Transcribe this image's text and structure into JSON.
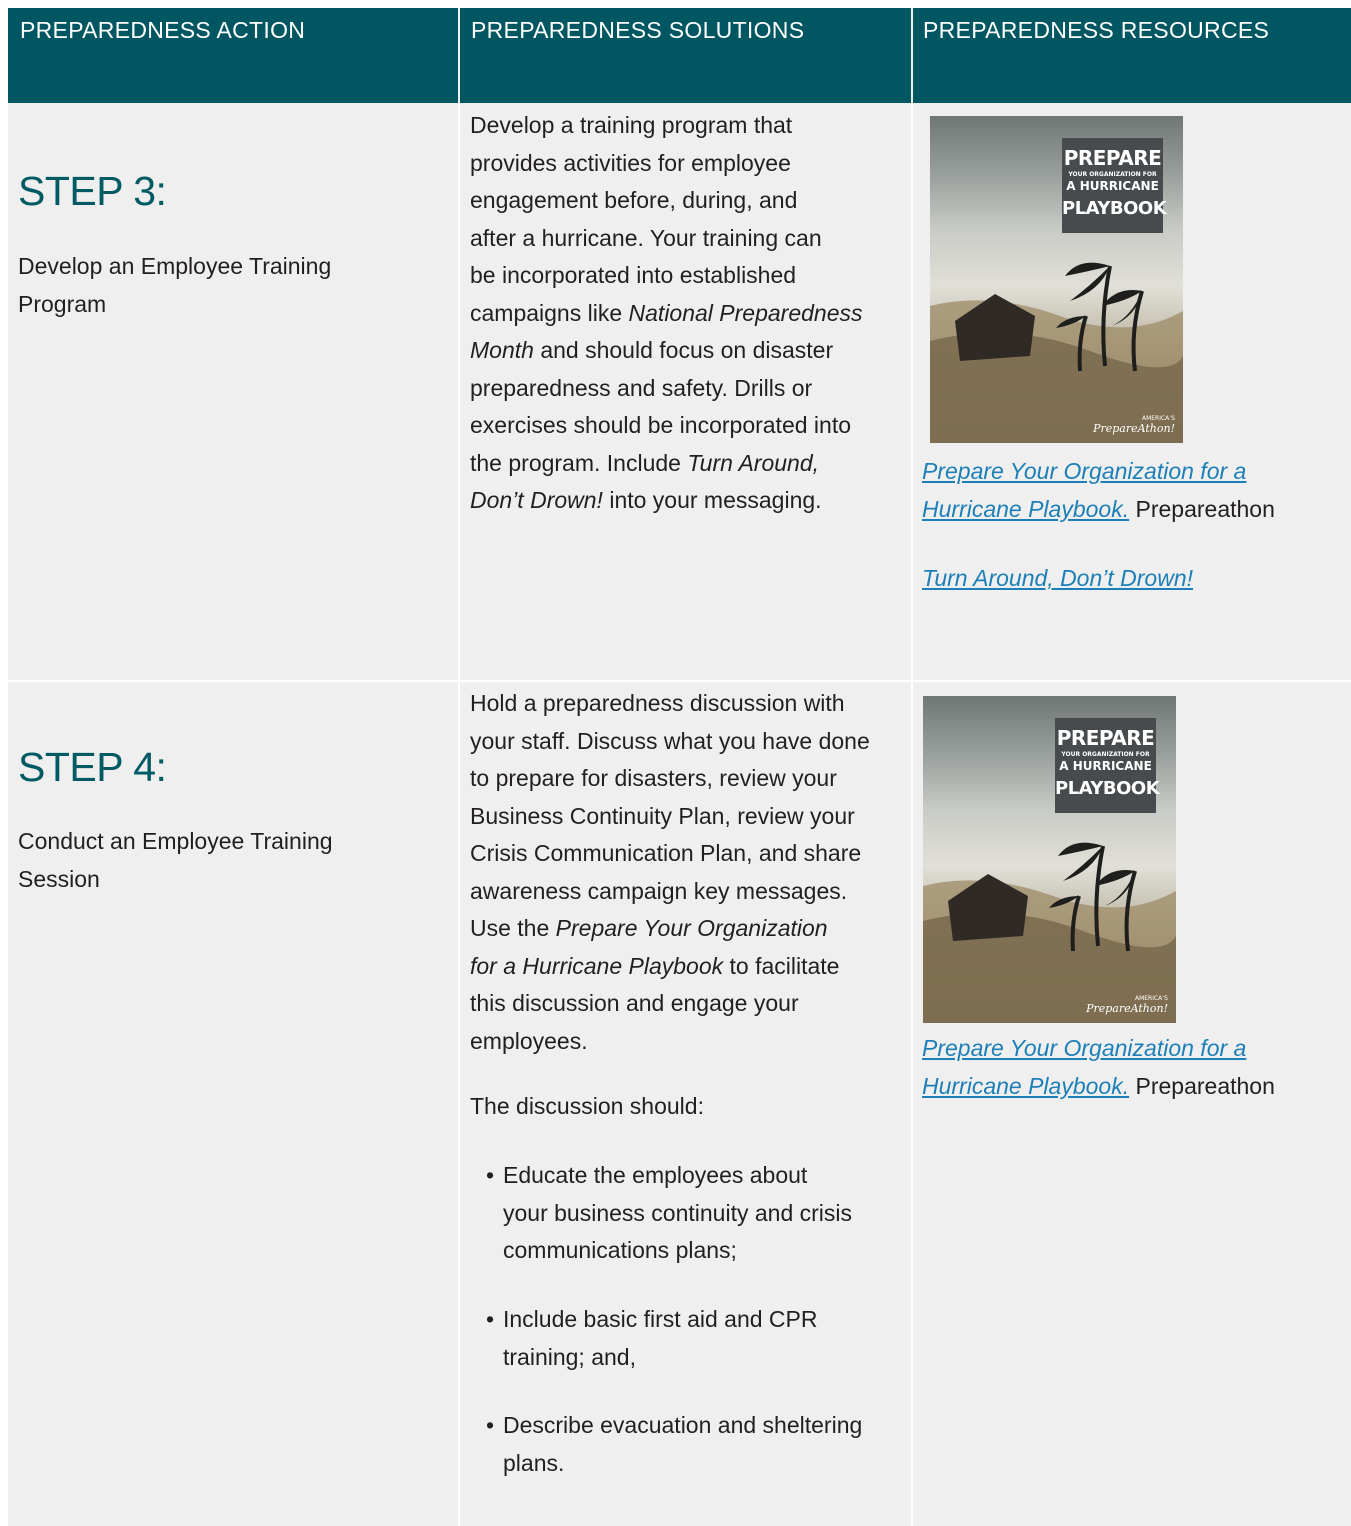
{
  "headers": {
    "action": "PREPAREDNESS ACTION",
    "solutions": "PREPAREDNESS SOLUTIONS",
    "resources": "PREPAREDNESS RESOURCES"
  },
  "rows": [
    {
      "step": "STEP 3:",
      "action": "Develop an Employee Training Program",
      "solution": {
        "lines": [
          "Develop a training program that",
          "provides activities for employee",
          "engagement before, during, and",
          "after a hurricane. Your training can",
          "be incorporated into established",
          "campaigns like "
        ],
        "l6_italic": "National Preparedness",
        "l7_italic": "Month",
        "l7_rest": " and should focus on disaster",
        "l8": "preparedness and safety. Drills or",
        "l9": "exercises should be incorporated into",
        "l10_pre": "the program. Include ",
        "l10_italic": "Turn Around,",
        "l11_italic": "Don’t Drown!",
        "l11_rest": " into your messaging."
      },
      "resources": {
        "cover": {
          "title1": "PREPARE",
          "title2": "YOUR ORGANIZATION FOR",
          "title3": "A HURRICANE",
          "title4": "PLAYBOOK",
          "brand_small": "AMERICA’S",
          "brand": "PrepareAthon!"
        },
        "link1_line1": "Prepare Your Organization for a ",
        "link1_line2": "Hurricane Playbook.",
        "link1_source": " Prepareathon",
        "link2": "Turn Around, Don’t Drown!"
      }
    },
    {
      "step": "STEP 4:",
      "action": "Conduct an Employee Training Session",
      "solution": {
        "lines": [
          "Hold a preparedness discussion with",
          "your staff. Discuss what you have done",
          "to prepare for disasters, review your",
          "Business Continuity Plan, review your",
          "Crisis Communication Plan, and share",
          "awareness campaign key messages."
        ],
        "l7_pre": "Use the ",
        "l7_italic": "Prepare Your Organization",
        "l8_italic": "for a Hurricane Playbook",
        "l8_rest": " to facilitate",
        "l9": "this discussion and engage your",
        "l10": "employees.",
        "intro": "The discussion should:",
        "bullets": [
          [
            "Educate the employees about",
            "your business continuity and crisis",
            "communications plans;"
          ],
          [
            "Include basic first aid and CPR",
            "training; and,"
          ],
          [
            "Describe evacuation and sheltering",
            "plans."
          ]
        ]
      },
      "resources": {
        "cover": {
          "title1": "PREPARE",
          "title2": "YOUR ORGANIZATION FOR",
          "title3": "A HURRICANE",
          "title4": "PLAYBOOK",
          "brand_small": "AMERICA’S",
          "brand": "PrepareAthon!"
        },
        "link1_line1": "Prepare Your Organization for a ",
        "link1_line2": "Hurricane Playbook.",
        "link1_source": " Prepareathon"
      }
    }
  ]
}
